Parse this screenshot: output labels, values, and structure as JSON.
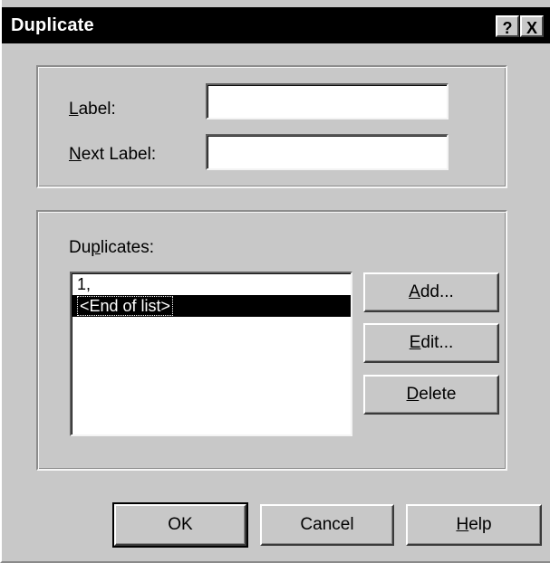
{
  "window": {
    "title": "Duplicate",
    "help_button": "?",
    "close_button": "X"
  },
  "labels_group": {
    "label_caption": {
      "mnemonic": "L",
      "rest": "abel:"
    },
    "label_value": "",
    "next_label_caption": {
      "mnemonic": "N",
      "rest": "ext Label:"
    },
    "next_label_value": ""
  },
  "duplicates_group": {
    "caption": {
      "pre": "Du",
      "mnemonic": "p",
      "rest": "licates:"
    },
    "items": [
      "1,",
      "<End of list>"
    ],
    "selected_index": 1,
    "buttons": {
      "add": {
        "mnemonic": "A",
        "rest": "dd..."
      },
      "edit": {
        "mnemonic": "E",
        "rest": "dit..."
      },
      "delete": {
        "mnemonic": "D",
        "rest": "elete"
      }
    }
  },
  "footer": {
    "ok_label": "OK",
    "cancel_label": "Cancel",
    "help_label": {
      "mnemonic": "H",
      "rest": "elp"
    }
  }
}
